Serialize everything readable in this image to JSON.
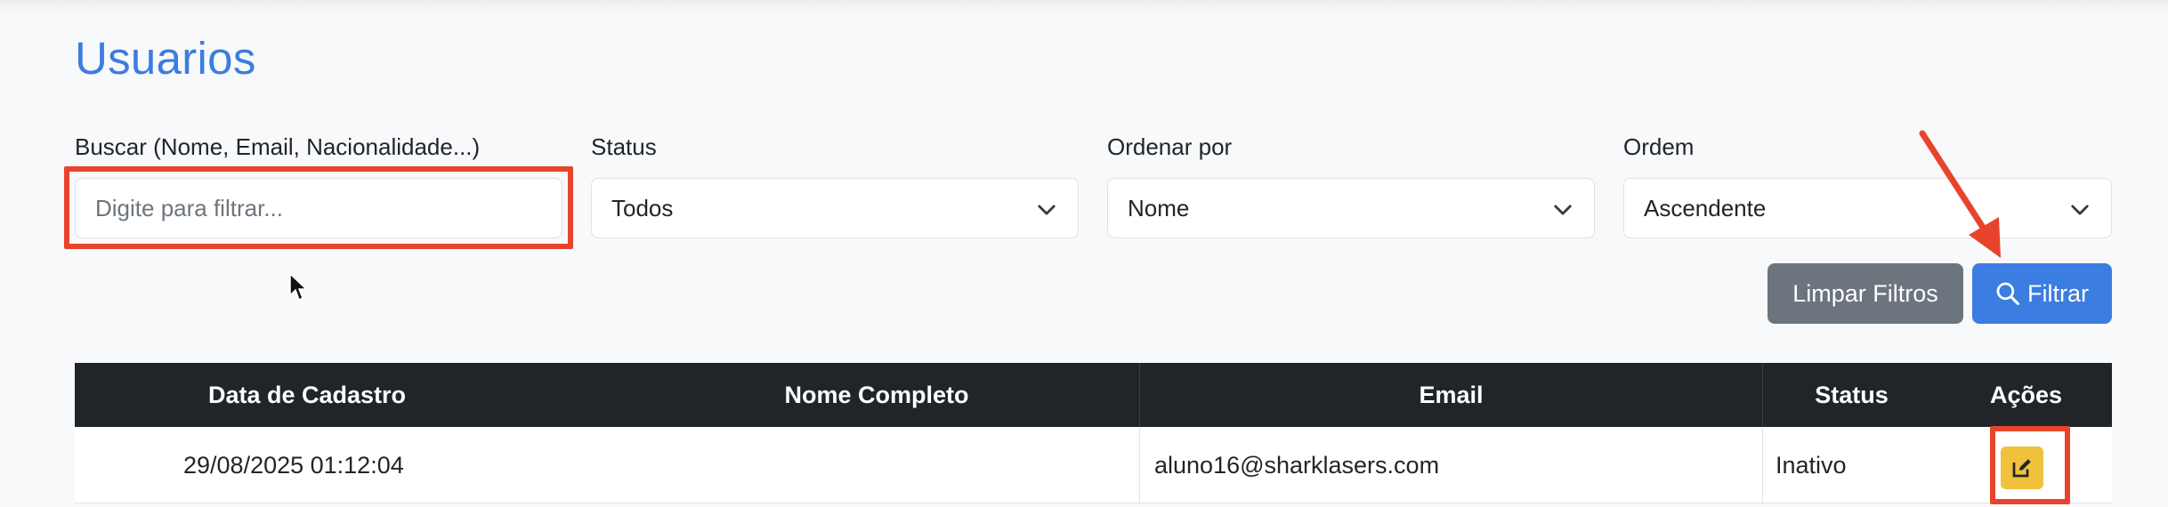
{
  "page": {
    "title": "Usuarios"
  },
  "filters": {
    "search": {
      "label": "Buscar (Nome, Email, Nacionalidade...)",
      "placeholder": "Digite para filtrar..."
    },
    "status": {
      "label": "Status",
      "value": "Todos"
    },
    "sort_by": {
      "label": "Ordenar por",
      "value": "Nome"
    },
    "order": {
      "label": "Ordem",
      "value": "Ascendente"
    }
  },
  "actions": {
    "clear_label": "Limpar Filtros",
    "filter_label": "Filtrar"
  },
  "table": {
    "headers": [
      "Data de Cadastro",
      "Nome Completo",
      "Email",
      "Status",
      "Ações"
    ],
    "rows": [
      {
        "date": "29/08/2025 01:12:04",
        "name": "",
        "email": "aluno16@sharklasers.com",
        "status": "Inativo"
      }
    ]
  },
  "colors": {
    "title": "#3b7de0",
    "primary": "#3b7de0",
    "secondary": "#6c757d",
    "warning": "#f0c23c",
    "table_header": "#212529",
    "annotation": "#e8442d"
  },
  "icons": {
    "dropdown": "chevron-down-icon",
    "filter_button": "search-icon",
    "edit_button": "edit-icon"
  }
}
